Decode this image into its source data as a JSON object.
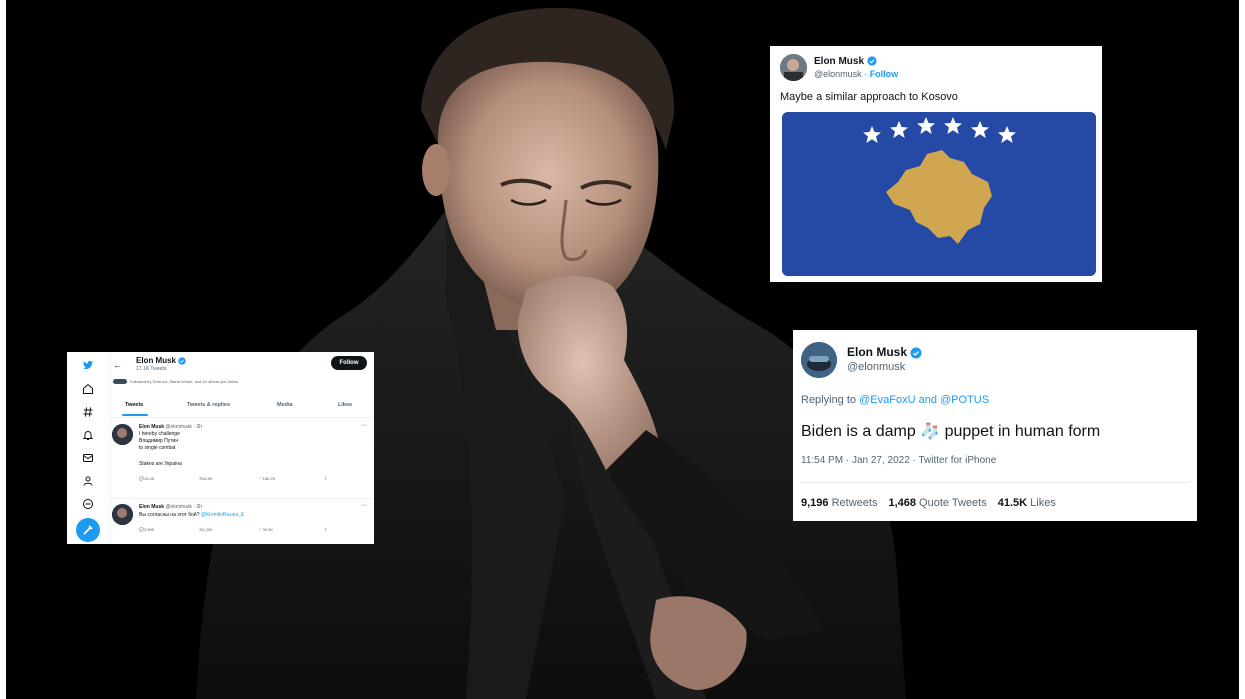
{
  "colors": {
    "twitter_blue": "#1d9bf0",
    "kosovo_blue": "#244aa5",
    "kosovo_gold": "#d0a650"
  },
  "kosovo_tweet": {
    "name": "Elon Musk",
    "handle": "@elonmusk",
    "separator": "·",
    "follow": "Follow",
    "text": "Maybe a similar approach to Kosovo"
  },
  "biden_tweet": {
    "name": "Elon Musk",
    "handle": "@elonmusk",
    "replying_to_prefix": "Replying to",
    "mention_1": "@EvaFoxU",
    "and": "and",
    "mention_2": "@POTUS",
    "text_before": "Biden is a damp",
    "emoji": "🧦",
    "text_after": "puppet in human form",
    "timestamp": "11:54 PM · Jan 27, 2022 · Twitter for iPhone",
    "stats": [
      {
        "count": "9,196",
        "label": "Retweets"
      },
      {
        "count": "1,468",
        "label": "Quote Tweets"
      },
      {
        "count": "41.5K",
        "label": "Likes"
      }
    ]
  },
  "profile_card": {
    "back_icon": "←",
    "name": "Elon Musk",
    "tweet_count": "17.1K Tweets",
    "followed_by": "Followed by Term.ink, Marta Windo, and 40 others you follow",
    "follow_button": "Follow",
    "tabs": [
      "Tweets",
      "Tweets & replies",
      "Media",
      "Likes"
    ],
    "tweets": [
      {
        "name": "Elon Musk",
        "handle": "@elonmusk · 2h",
        "lines": [
          "I hereby challenge",
          "Владимир Путин",
          "to single combat",
          "",
          "Stakes are Україна"
        ],
        "actions": [
          "15.4K",
          "40.9K",
          "180.2K"
        ]
      },
      {
        "name": "Elon Musk",
        "handle": "@elonmusk · 2h",
        "line_text": "Вы согласны на этот бой?",
        "line_mention": "@KremlinRussia_E",
        "actions": [
          "2,895",
          "4,200",
          "39.3K"
        ]
      }
    ]
  }
}
